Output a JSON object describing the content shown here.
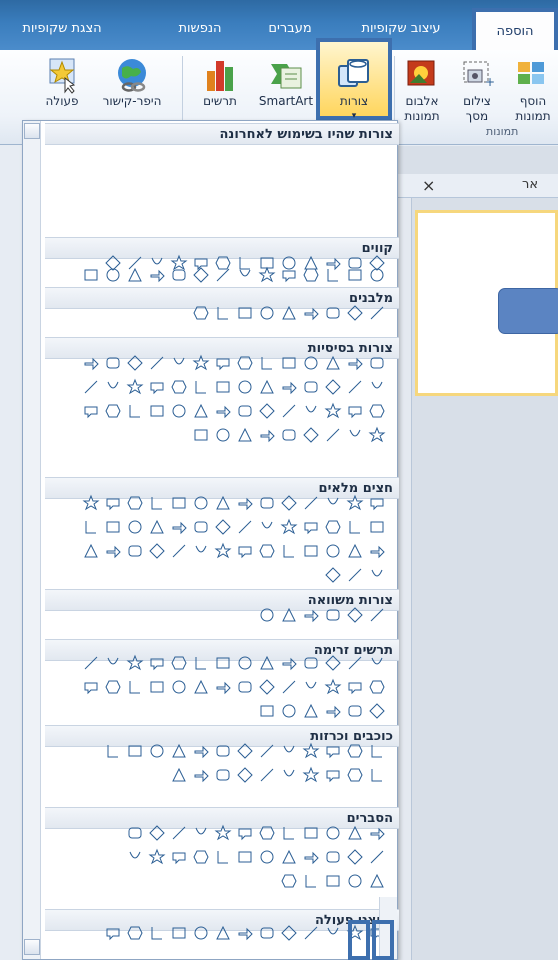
{
  "tabs": [
    {
      "label": "הוספה",
      "active": true
    },
    {
      "label": "עיצוב שקופיות",
      "active": false
    },
    {
      "label": "מעברים",
      "active": false
    },
    {
      "label": "הנפשות",
      "active": false
    },
    {
      "label": "הצגת שקופיות",
      "active": false
    }
  ],
  "ribbon": {
    "buttons": {
      "action": "פעולה",
      "hyperlink": "היפר-קישור",
      "charts": "תרשים",
      "smartart": "SmartArt",
      "shapes": "צורות",
      "album_top": "אלבום",
      "album_bottom": "תמונות",
      "screenshot_top": "צילום",
      "screenshot_bottom": "מסך",
      "add_top": "הוסף",
      "add_bottom": "תמונות"
    },
    "group_images": "תמונות"
  },
  "gallery": {
    "categories": [
      {
        "label": "צורות שהיו בשימוש לאחרונה"
      },
      {
        "label": "קווים"
      },
      {
        "label": "מלבנים"
      },
      {
        "label": "צורות בסיסיות"
      },
      {
        "label": "חצים מלאים"
      },
      {
        "label": "צורות משוואה"
      },
      {
        "label": "תרשים זרימה"
      },
      {
        "label": "כוכבים וכרזות"
      },
      {
        "label": "הסברים"
      },
      {
        "label": "לחצני פעולה"
      }
    ]
  },
  "slide_pane": {
    "tab_label": "אר",
    "close": "×"
  },
  "colors": {
    "accent": "#3d6fae",
    "tab_bar": "#3a7dbd",
    "shape_stroke": "#2b5e94",
    "thumb_shape": "#5b84c2",
    "selected": "#f6d77d"
  }
}
